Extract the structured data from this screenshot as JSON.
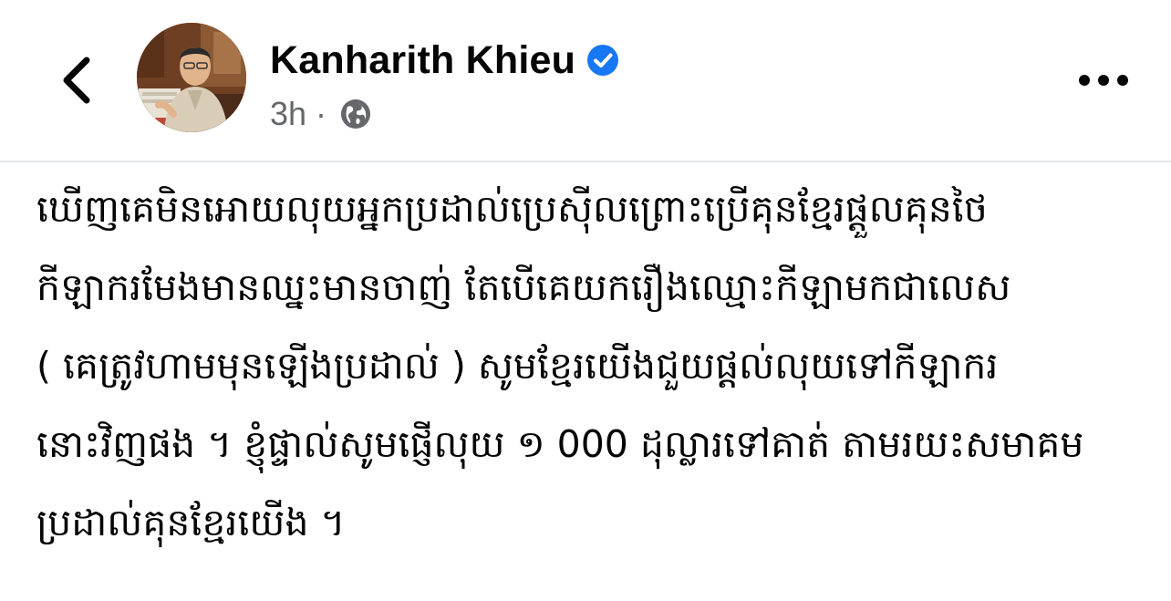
{
  "header": {
    "author_name": "Kanharith Khieu",
    "timestamp": "3h",
    "separator": "·",
    "verified": true,
    "privacy": "globe-icon"
  },
  "post": {
    "lines": [
      "ឃើញគេមិនអោយលុយអ្នកប្រដាល់ប្រេសុីលព្រោះប្រើគុនខ្មែរផ្តួលគុនថៃ",
      "កីឡាករមែងមានឈ្នះមានចាញ់ តែបើគេយករឿងឈ្មោះកីឡាមកជាលេស",
      "( គេត្រូវហាមមុនឡើងប្រដាល់ ) សូមខ្មែរយើងជួយផ្តល់លុយទៅកីឡាករ",
      "នោះវិញផង ។ ខ្ញុំផ្ទាល់សូមផ្ញើលុយ ១ 000 ដុល្លារទៅគាត់ តាមរយះសមាគម",
      "ប្រដាល់គុនខ្មែរយើង ។"
    ]
  },
  "icons": {
    "back": "chevron-left-icon",
    "verified": "verified-badge-icon",
    "privacy": "globe-icon",
    "more": "more-options-icon"
  },
  "colors": {
    "text": "#050505",
    "secondary_text": "#65676b",
    "verified_blue": "#1877f2",
    "divider": "#e4e6eb",
    "background": "#ffffff"
  }
}
